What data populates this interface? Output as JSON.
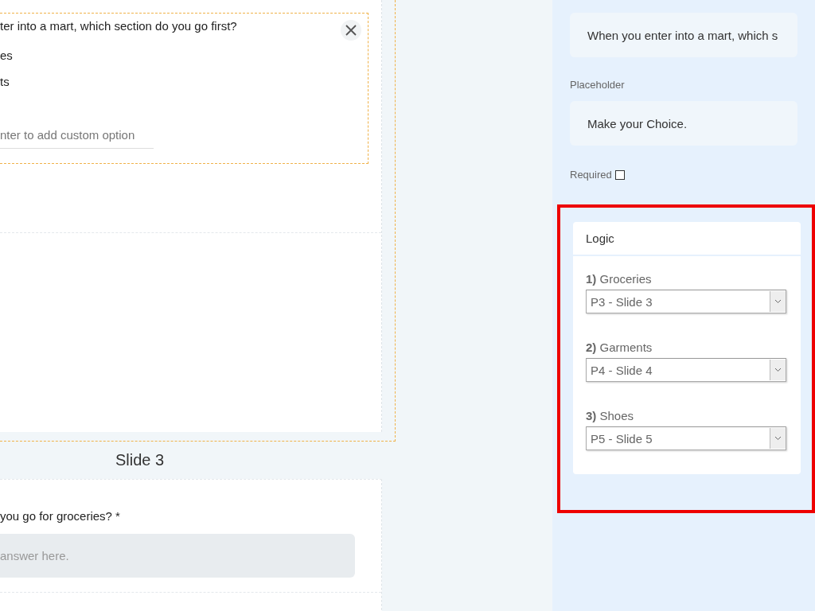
{
  "editor": {
    "question": {
      "title": "ter into a mart, which section do you go first?",
      "options": [
        "es",
        "ts"
      ],
      "custom_option": {
        "placeholder": "nter to add custom option"
      }
    },
    "next_slide": {
      "heading": "Slide 3",
      "question": "you go for groceries? *",
      "answer": {
        "placeholder": "answer here."
      }
    }
  },
  "properties": {
    "field_title": {
      "value": "When you enter into a mart, which s"
    },
    "placeholder_label": "Placeholder",
    "placeholder_field": {
      "value": "Make your Choice."
    },
    "required": {
      "label": "Required",
      "checked": false
    },
    "logic": {
      "title": "Logic",
      "highlighted": true,
      "rules": [
        {
          "number": "1)",
          "option": "Groceries",
          "target": "P3 - Slide 3"
        },
        {
          "number": "2)",
          "option": "Garments",
          "target": "P4 - Slide 4"
        },
        {
          "number": "3)",
          "option": "Shoes",
          "target": "P5 - Slide 5"
        }
      ]
    }
  }
}
